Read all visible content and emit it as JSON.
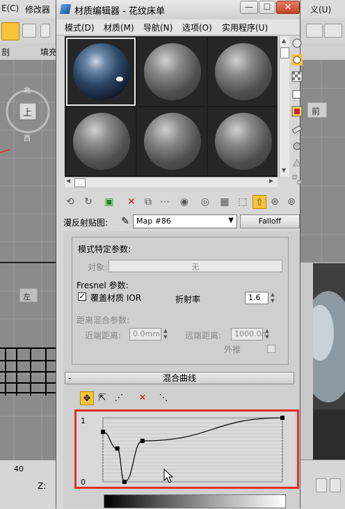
{
  "background": {
    "menu_left": "E(C)",
    "menu_modify": "修改器",
    "menu_right": "义(U)",
    "tab_left": "剖",
    "tab_fill": "填充",
    "front_label": "前",
    "left_label": "左",
    "compass_top": "北",
    "compass_bottom": "西",
    "compass_center": "上",
    "status_num": "40",
    "status_z": "Z:"
  },
  "window": {
    "title": "材质编辑器 - 花纹床单",
    "minimize": "—",
    "maximize": "☐",
    "close": "✕"
  },
  "menu": [
    "模式(D)",
    "材质(M)",
    "导航(N)",
    "选项(O)",
    "实用程序(U)"
  ],
  "map": {
    "label": "漫反射贴图:",
    "name": "Map #86",
    "type_button": "Falloff"
  },
  "mode_params": {
    "title": "模式特定参数:",
    "object_label": "对象:",
    "object_value": "无",
    "fresnel_title": "Fresnel 参数:",
    "override_ior_label": "覆盖材质 IOR",
    "override_ior_checked": true,
    "ior_label": "折射率",
    "ior_value": "1.6",
    "distance_title": "距离混合参数:",
    "near_label": "近端距离:",
    "near_value": "0.0mm",
    "far_label": "远端距离:",
    "far_value": "1000.0m",
    "extrapolate_label": "外推"
  },
  "mix_curve": {
    "rollout_title": "混合曲线",
    "collapse_symbol": "-",
    "y_max_label": "1",
    "y_min_label": "0"
  },
  "curve_data": {
    "points": [
      [
        0,
        0.78
      ],
      [
        0.08,
        0.52
      ],
      [
        0.12,
        0.0
      ],
      [
        0.22,
        0.64
      ],
      [
        1.0,
        1.0
      ]
    ]
  },
  "colors": {
    "highlight_box": "#e0302a",
    "active_tool": "#f7c43a"
  }
}
